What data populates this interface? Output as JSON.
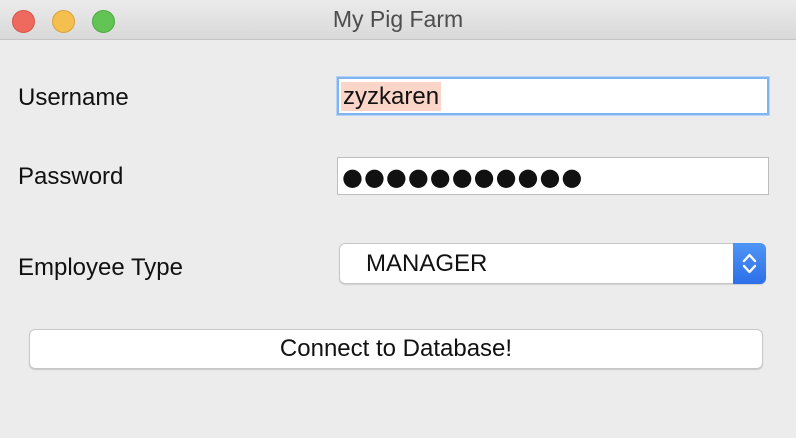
{
  "window": {
    "title": "My Pig Farm",
    "traffic_lights": {
      "close_color": "#ee6a5e",
      "minimize_color": "#f5bf4f",
      "zoom_color": "#61c454"
    }
  },
  "form": {
    "username": {
      "label": "Username",
      "value": "zyzkaren"
    },
    "password": {
      "label": "Password",
      "masked_value": "●●●●●●●●●●●"
    },
    "employee_type": {
      "label": "Employee Type",
      "selected": "MANAGER",
      "icon": "chevron-up-down-icon"
    },
    "connect_button_label": "Connect to Database!"
  },
  "colors": {
    "selection_highlight": "#fbd6c8",
    "focus_ring": "#7fb4f3",
    "select_accent": "#2d6fe8"
  }
}
